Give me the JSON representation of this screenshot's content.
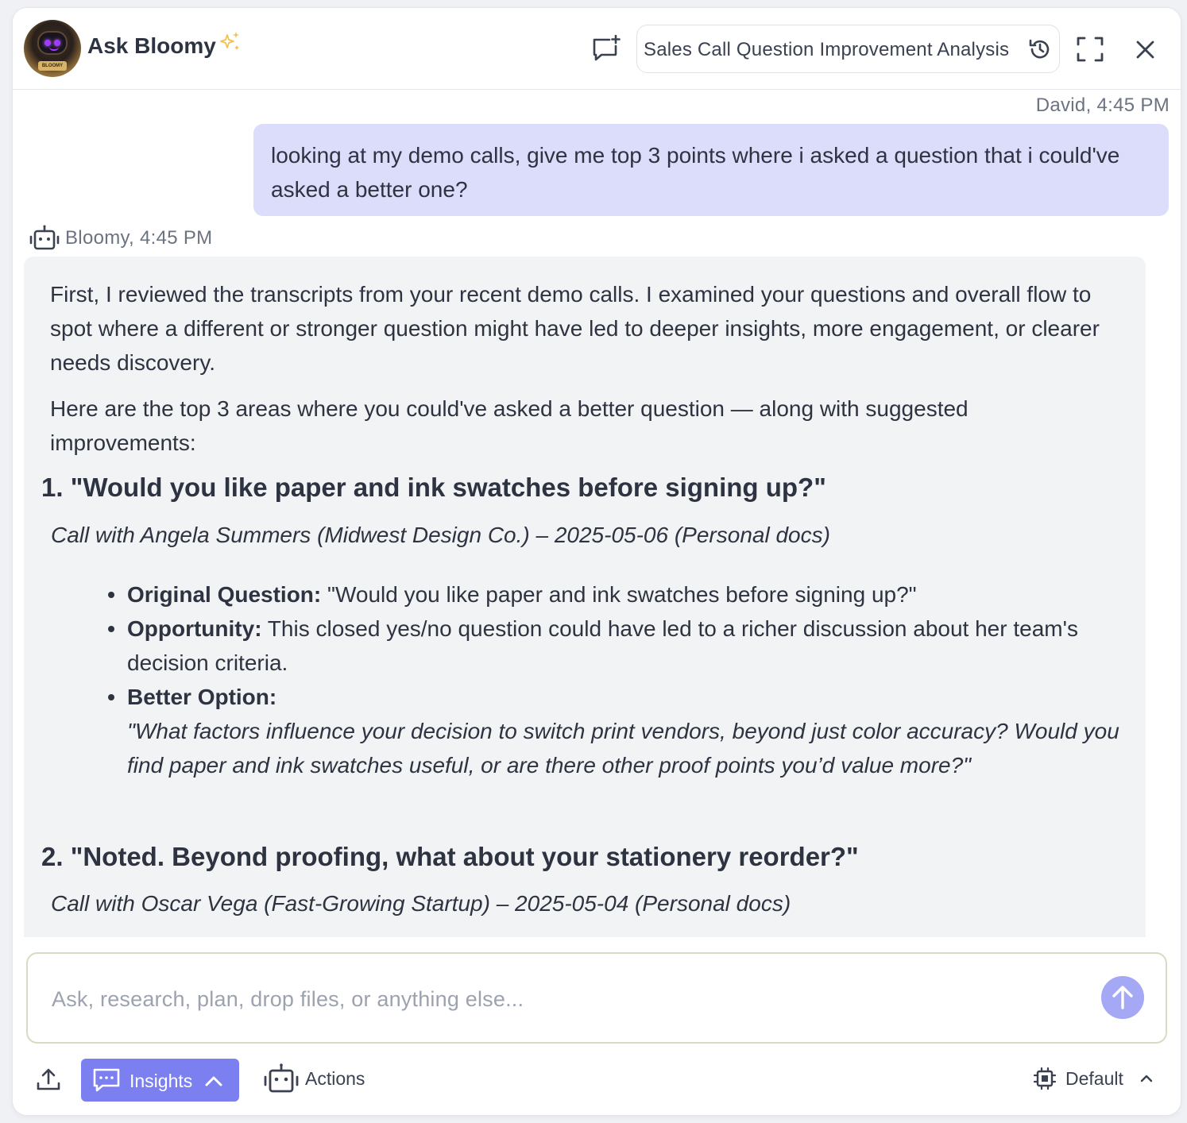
{
  "header": {
    "title": "Ask Bloomy",
    "avatar_plate": "BLOOMY",
    "thread_title": "Sales Call Question Improvement Analysis",
    "icons": [
      "new-chat-icon",
      "history-icon",
      "fullscreen-icon",
      "close-icon"
    ]
  },
  "conversation": {
    "user_meta": "David, 4:45 PM",
    "user_message": "looking at my demo calls, give me top 3 points where i asked a question that i could've asked a better one?",
    "bot_meta": "Bloomy, 4:45 PM",
    "intro_1": "First, I reviewed the transcripts from your recent demo calls. I examined your questions and overall flow to spot where a different or stronger question might have led to deeper insights, more engagement, or clearer needs discovery.",
    "intro_2": "Here are the top 3 areas where you could've asked a better question — along with suggested improvements:",
    "items": [
      {
        "heading": "1. \"Would you like paper and ink swatches before signing up?\"",
        "source": "Call with Angela Summers (Midwest Design Co.) – 2025-05-06 (Personal docs)",
        "original_label": "Original Question:",
        "original_text": " \"Would you like paper and ink swatches before signing up?\"",
        "opportunity_label": "Opportunity:",
        "opportunity_text": " This closed yes/no question could have led to a richer discussion about her team's decision criteria.",
        "better_label": "Better Option:",
        "better_text": "\"What factors influence your decision to switch print vendors, beyond just color accuracy? Would you find paper and ink swatches useful, or are there other proof points you’d value more?\""
      },
      {
        "heading": "2. \"Noted. Beyond proofing, what about your stationery reorder?\"",
        "source": "Call with Oscar Vega (Fast-Growing Startup) – 2025-05-04 (Personal docs)"
      }
    ]
  },
  "composer": {
    "placeholder": "Ask, research, plan, drop files, or anything else...",
    "insights_label": "Insights",
    "actions_label": "Actions",
    "model_label": "Default"
  },
  "colors": {
    "accent": "#7b7ff0",
    "user_bubble": "#dcdcfb",
    "bot_bubble": "#f2f3f5",
    "send_button": "#a5a8f5",
    "sparkle": "#f2c14e"
  }
}
